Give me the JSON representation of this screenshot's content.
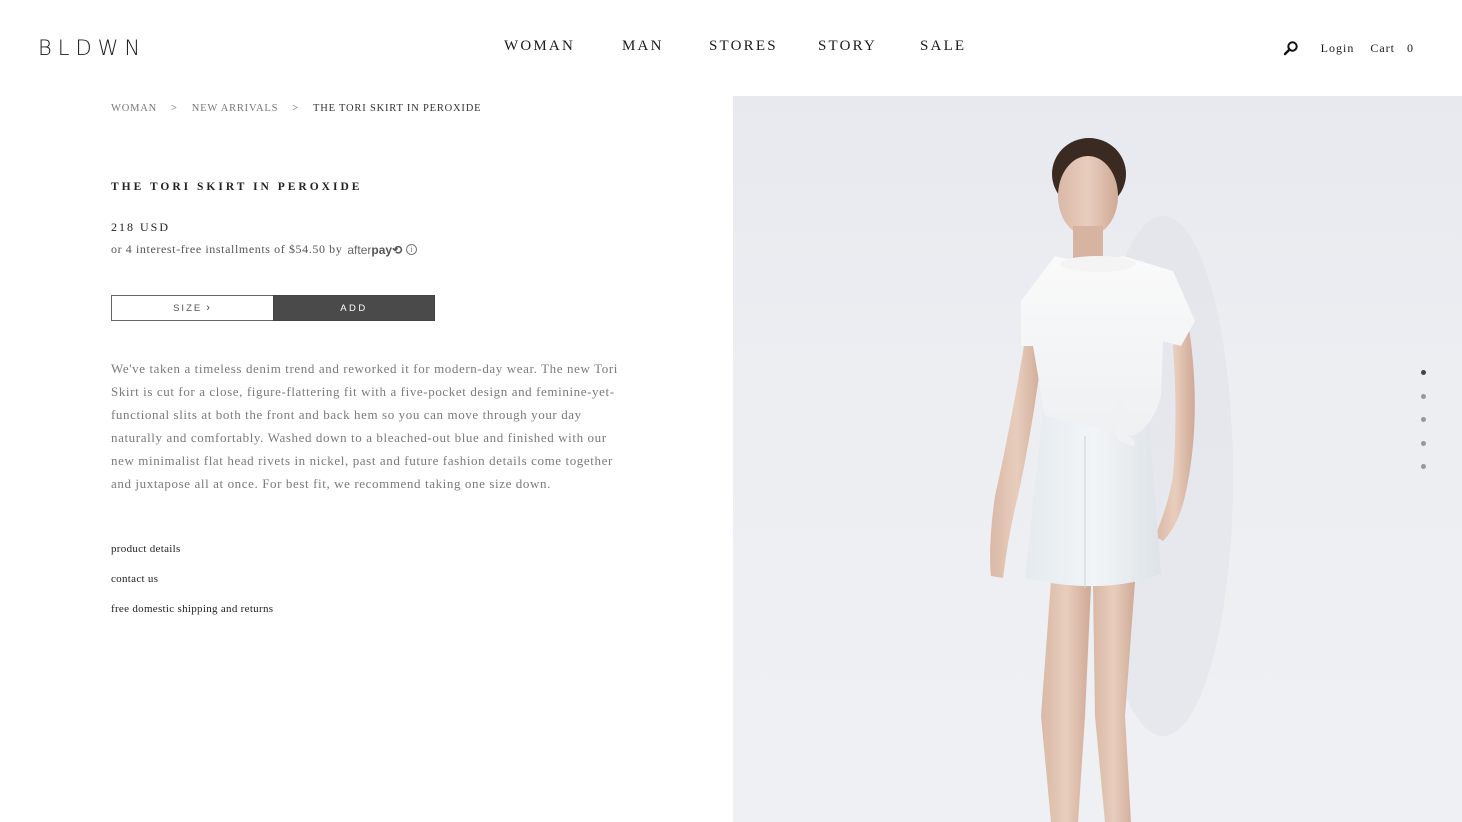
{
  "brand": {
    "logo": "BLDWN"
  },
  "nav": {
    "items": [
      {
        "label": "WOMAN"
      },
      {
        "label": "MAN"
      },
      {
        "label": "STORES"
      },
      {
        "label": "STORY"
      },
      {
        "label": "SALE"
      }
    ]
  },
  "utility": {
    "search_icon": "search-icon",
    "login_label": "Login",
    "cart_label": "Cart",
    "cart_count": "0"
  },
  "breadcrumb": {
    "items": [
      {
        "label": "WOMAN"
      },
      {
        "label": "NEW ARRIVALS"
      },
      {
        "label": "THE TORI SKIRT IN PEROXIDE"
      }
    ],
    "separator": ">"
  },
  "product": {
    "title": "THE TORI SKIRT IN PEROXIDE",
    "price": "218 USD",
    "installments_text": "or 4 interest-free installments of $54.50 by",
    "afterpay_prefix": "after",
    "afterpay_brand": "pay",
    "afterpay_mark": "⟲",
    "info_icon": "ⓘ",
    "size_label": "SIZE",
    "add_label": "ADD",
    "description": "We've taken a timeless denim trend and reworked it for modern-day wear. The new Tori Skirt is cut for a close, figure-flattering fit with a five-pocket design and feminine-yet-functional slits at both the front and back hem so you can move through your day naturally and comfortably. Washed down to a bleached-out blue and finished with our new minimalist flat head rivets in nickel, past and future fashion details come together and juxtapose all at once. For best fit, we recommend taking one size down.",
    "links": [
      {
        "label": "product details"
      },
      {
        "label": "contact us"
      },
      {
        "label": "free domestic shipping and returns"
      }
    ]
  },
  "gallery": {
    "total_images": 5,
    "active_index": 0
  },
  "colors": {
    "add_button_bg": "#4a4a4a",
    "image_bg": "#e9ebf0",
    "text_muted": "#7a7a7a"
  }
}
